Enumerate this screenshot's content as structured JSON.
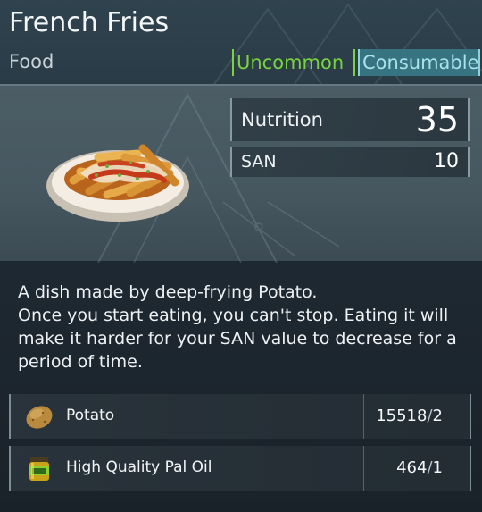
{
  "item": {
    "name": "French Fries",
    "category": "Food",
    "rarity": "Uncommon",
    "type": "Consumable",
    "icon": "french-fries-plate"
  },
  "stats": {
    "nutrition_label": "Nutrition",
    "nutrition_value": "35",
    "san_label": "SAN",
    "san_value": "10"
  },
  "description": "A dish made by deep-frying Potato.\nOnce you start eating, you can't stop. Eating it will make it harder for your SAN value to decrease for a period of time.",
  "ingredients": [
    {
      "name": "Potato",
      "owned": "15518",
      "required": "2",
      "icon": "potato-icon"
    },
    {
      "name": "High Quality Pal Oil",
      "owned": "464",
      "required": "1",
      "icon": "pal-oil-jar-icon"
    }
  ],
  "colors": {
    "rarity": "#7ad23f",
    "type_bg": "#357480",
    "type_text": "#a9e2ea"
  }
}
